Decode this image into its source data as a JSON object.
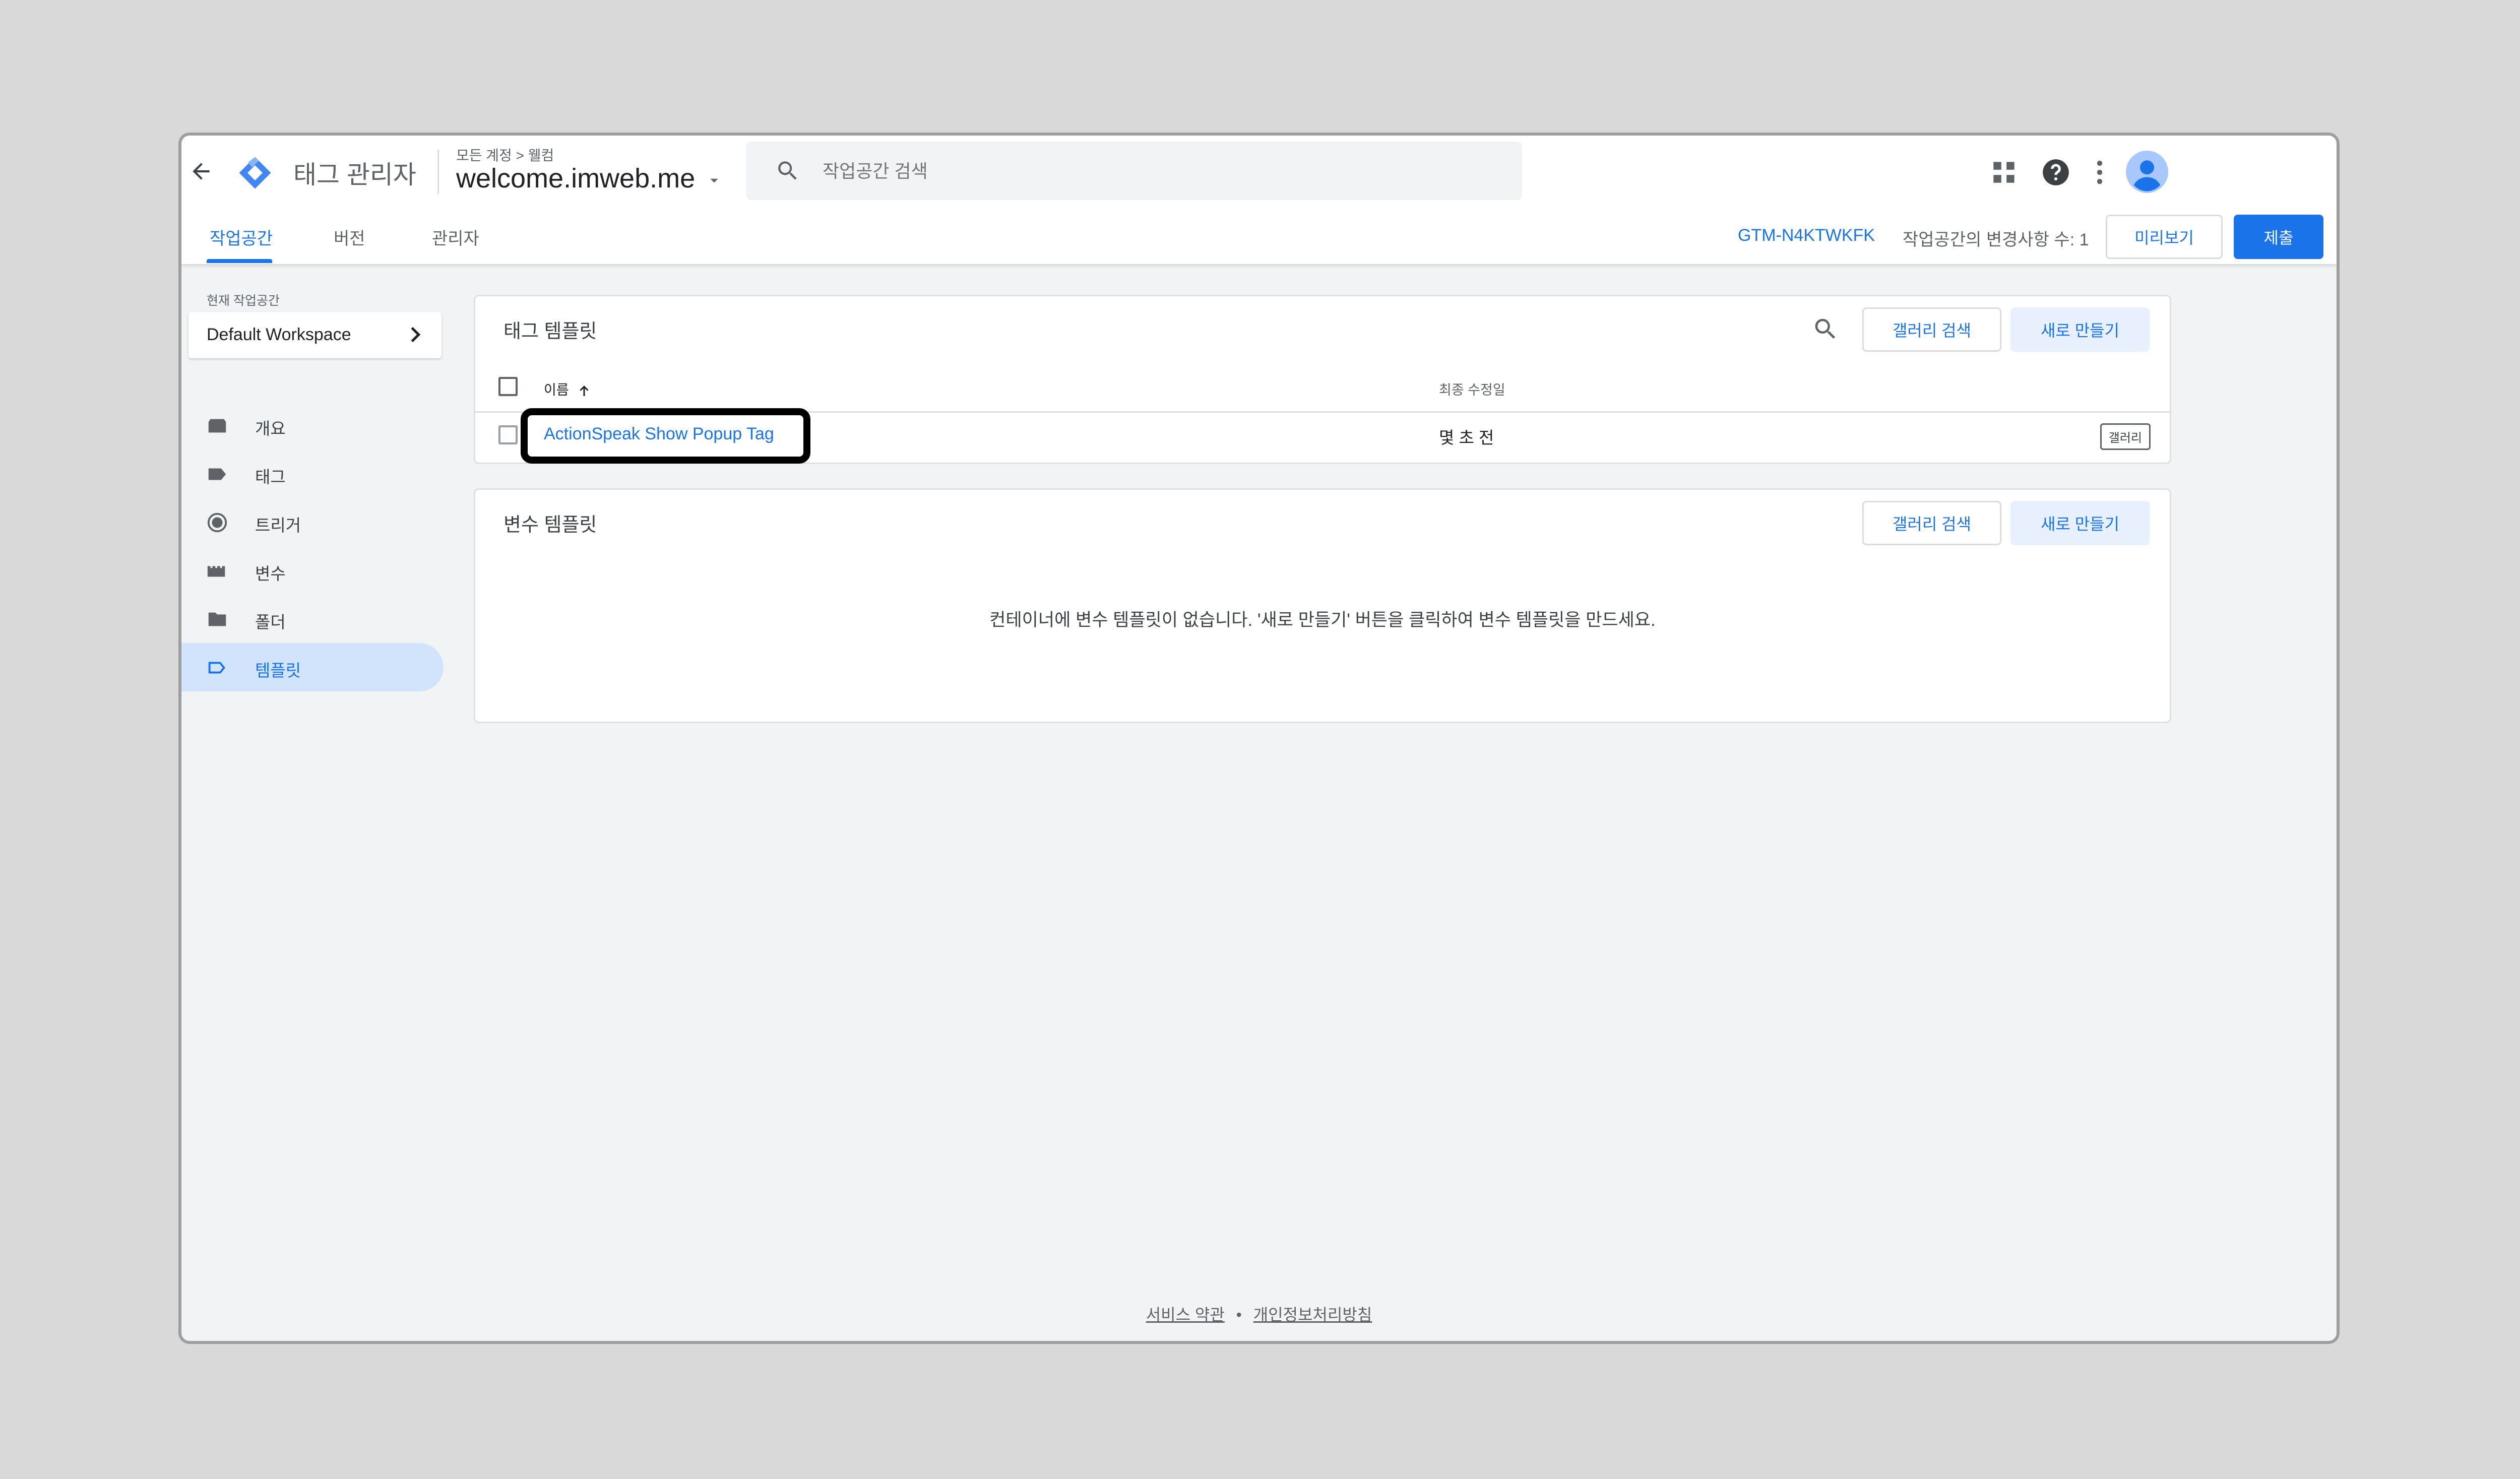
{
  "header": {
    "app_name": "태그 관리자",
    "breadcrumb": "모든 계정 > 웰컴",
    "container_name": "welcome.imweb.me",
    "search_placeholder": "작업공간 검색"
  },
  "tabs": [
    {
      "label": "작업공간",
      "active": true
    },
    {
      "label": "버전",
      "active": false
    },
    {
      "label": "관리자",
      "active": false
    }
  ],
  "toolbar": {
    "container_id": "GTM-N4KTWKFK",
    "changes_text": "작업공간의 변경사항 수: 1",
    "preview_label": "미리보기",
    "submit_label": "제출"
  },
  "sidebar": {
    "workspace_label": "현재 작업공간",
    "workspace_name": "Default Workspace",
    "items": [
      {
        "label": "개요",
        "icon": "overview-icon"
      },
      {
        "label": "태그",
        "icon": "tag-icon"
      },
      {
        "label": "트리거",
        "icon": "trigger-icon"
      },
      {
        "label": "변수",
        "icon": "variable-icon"
      },
      {
        "label": "폴더",
        "icon": "folder-icon"
      },
      {
        "label": "템플릿",
        "icon": "template-icon",
        "active": true
      }
    ]
  },
  "tag_templates": {
    "title": "태그 템플릿",
    "gallery_search_label": "갤러리 검색",
    "new_label": "새로 만들기",
    "columns": [
      "이름",
      "최종 수정일"
    ],
    "rows": [
      {
        "name": "ActionSpeak Show Popup Tag",
        "modified": "몇 초 전",
        "badge": "갤러리"
      }
    ]
  },
  "variable_templates": {
    "title": "변수 템플릿",
    "gallery_search_label": "갤러리 검색",
    "new_label": "새로 만들기",
    "empty_message": "컨테이너에 변수 템플릿이 없습니다. '새로 만들기' 버튼을 클릭하여 변수 템플릿을 만드세요."
  },
  "footer": {
    "terms": "서비스 약관",
    "separator": "•",
    "privacy": "개인정보처리방침"
  },
  "colors": {
    "accent": "#1a73e8",
    "highlight_border": "#000000",
    "active_nav_bg": "#d2e3fc"
  }
}
